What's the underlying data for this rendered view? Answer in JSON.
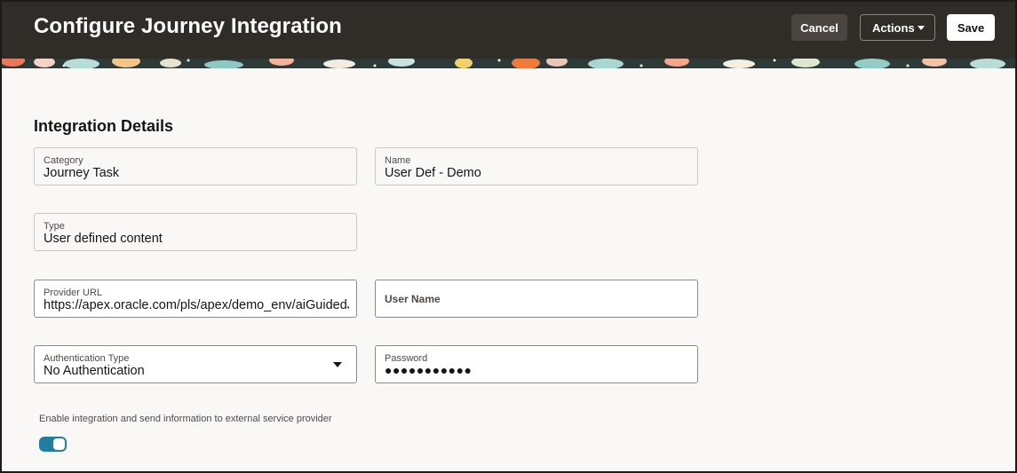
{
  "header": {
    "title": "Configure Journey Integration",
    "cancel_label": "Cancel",
    "actions_label": "Actions",
    "save_label": "Save"
  },
  "section": {
    "title": "Integration Details"
  },
  "fields": {
    "category": {
      "label": "Category",
      "value": "Journey Task"
    },
    "name": {
      "label": "Name",
      "value": "User Def - Demo"
    },
    "type": {
      "label": "Type",
      "value": "User defined content"
    },
    "provider_url": {
      "label": "Provider URL",
      "value": "https://apex.oracle.com/pls/apex/demo_env/aiGuidedJc"
    },
    "user_name": {
      "label": "User Name",
      "value": ""
    },
    "auth_type": {
      "label": "Authentication Type",
      "value": "No Authentication"
    },
    "password": {
      "label": "Password",
      "value": "●●●●●●●●●●●"
    }
  },
  "enable": {
    "label": "Enable integration and send information to external service provider",
    "enabled": true
  },
  "colors": {
    "header_bg": "#302c28",
    "page_bg": "#f9f8f7",
    "toggle_on": "#227e9e"
  }
}
